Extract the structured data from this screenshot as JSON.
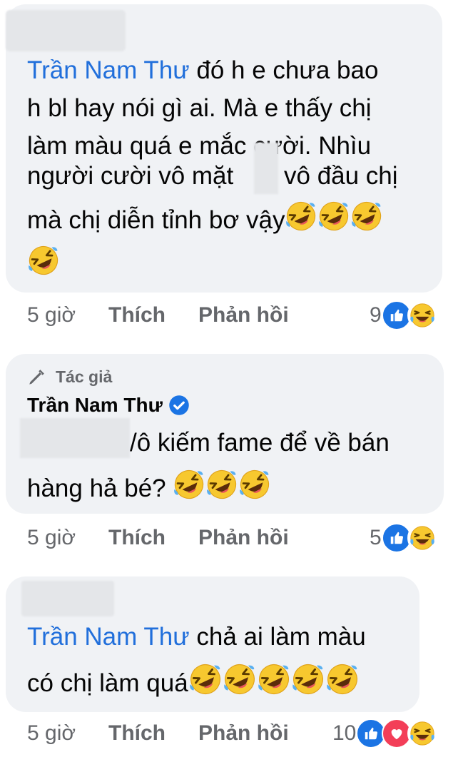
{
  "comments": [
    {
      "mention": "Trần Nam Thư",
      "lines": [
        "đó h e chưa bao",
        "h bl hay nói gì ai. Mà e thấy chị",
        "làm màu quá e mắc cười. Nhìu",
        "người cười vô mặt",
        "vô đầu chị",
        "mà chị diễn tỉnh bơ vậy"
      ],
      "time": "5 giờ",
      "like": "Thích",
      "reply": "Phản hồi",
      "reaction_count": "9",
      "reactions": [
        "like-icon",
        "haha-icon"
      ]
    },
    {
      "badge": "Tác giả",
      "author": "Trần Nam Thư",
      "lines": [
        "/ô kiếm fame để về bán",
        "hàng hả bé?"
      ],
      "time": "5 giờ",
      "like": "Thích",
      "reply": "Phản hồi",
      "reaction_count": "5",
      "reactions": [
        "like-icon",
        "haha-icon"
      ]
    },
    {
      "mention": "Trần Nam Thư",
      "lines": [
        "chả ai làm màu",
        "có chị làm quá"
      ],
      "time": "5 giờ",
      "like": "Thích",
      "reply": "Phản hồi",
      "reaction_count": "10",
      "reactions": [
        "like-icon",
        "love-icon",
        "haha-icon"
      ]
    }
  ],
  "colors": {
    "bubble": "#f0f2f5",
    "mention": "#216fdb",
    "meta": "#65676b",
    "like": "#1b74e4",
    "love": "#f33e58",
    "haha": "#f7b125"
  }
}
